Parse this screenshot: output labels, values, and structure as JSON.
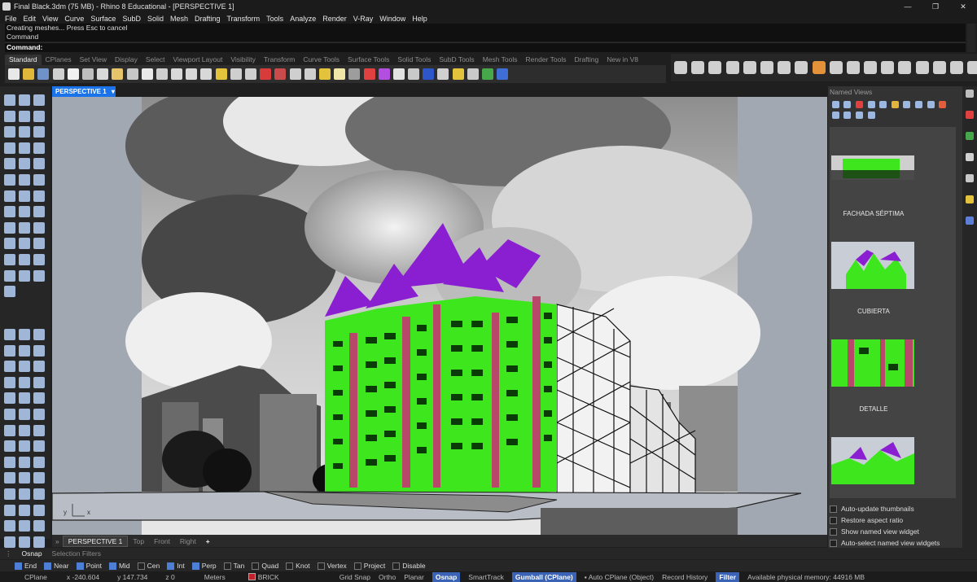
{
  "window": {
    "title": "Final Black.3dm (75 MB) - Rhino 8 Educational - [PERSPECTIVE 1]",
    "min": "—",
    "max": "❐",
    "close": "✕"
  },
  "menu": [
    "File",
    "Edit",
    "View",
    "Curve",
    "Surface",
    "SubD",
    "Solid",
    "Mesh",
    "Drafting",
    "Transform",
    "Tools",
    "Analyze",
    "Render",
    "V-Ray",
    "Window",
    "Help"
  ],
  "command": {
    "history_1": "Creating meshes... Press Esc to cancel",
    "history_2": "Command",
    "prompt": "Command:"
  },
  "toolbar_tabs": [
    {
      "label": "Standard",
      "active": true
    },
    {
      "label": "CPlanes"
    },
    {
      "label": "Set View"
    },
    {
      "label": "Display"
    },
    {
      "label": "Select"
    },
    {
      "label": "Viewport Layout"
    },
    {
      "label": "Visibility"
    },
    {
      "label": "Transform"
    },
    {
      "label": "Curve Tools"
    },
    {
      "label": "Surface Tools"
    },
    {
      "label": "Solid Tools"
    },
    {
      "label": "SubD Tools"
    },
    {
      "label": "Mesh Tools"
    },
    {
      "label": "Render Tools"
    },
    {
      "label": "Drafting"
    },
    {
      "label": "New in V8"
    }
  ],
  "viewport": {
    "name": "PERSPECTIVE 1",
    "dropdown": "▾",
    "axis_y": "y",
    "axis_x": "x"
  },
  "viewport_tabs": [
    {
      "label": "PERSPECTIVE 1",
      "active": true
    },
    {
      "label": "Top"
    },
    {
      "label": "Front"
    },
    {
      "label": "Right"
    },
    {
      "label": "+"
    }
  ],
  "named_views": {
    "title": "Named Views",
    "items": [
      {
        "name": "FACHADA SÉPTIMA"
      },
      {
        "name": "CUBIERTA"
      },
      {
        "name": "DETALLE"
      }
    ],
    "options": [
      {
        "label": "Auto-update thumbnails",
        "checked": false
      },
      {
        "label": "Restore aspect ratio",
        "checked": false
      },
      {
        "label": "Show named view widget",
        "checked": false
      },
      {
        "label": "Auto-select named view widgets",
        "checked": false
      }
    ]
  },
  "osnap_tabs": [
    "Osnap",
    "Selection Filters"
  ],
  "osnaps": [
    {
      "label": "End",
      "checked": true
    },
    {
      "label": "Near",
      "checked": true
    },
    {
      "label": "Point",
      "checked": true
    },
    {
      "label": "Mid",
      "checked": true
    },
    {
      "label": "Cen",
      "checked": false
    },
    {
      "label": "Int",
      "checked": true
    },
    {
      "label": "Perp",
      "checked": true
    },
    {
      "label": "Tan",
      "checked": false
    },
    {
      "label": "Quad",
      "checked": false
    },
    {
      "label": "Knot",
      "checked": false
    },
    {
      "label": "Vertex",
      "checked": false
    },
    {
      "label": "Project",
      "checked": false
    },
    {
      "label": "Disable",
      "checked": false
    }
  ],
  "status": {
    "cplane": "CPlane",
    "x": "x -240.604",
    "y": "y 147.734",
    "z": "z 0",
    "units": "Meters",
    "layer": "BRICK",
    "layer_color": "#c0222c",
    "grid_snap": "Grid Snap",
    "ortho": "Ortho",
    "planar": "Planar",
    "osnap": "Osnap",
    "smarttrack": "SmartTrack",
    "gumball": "Gumball (CPlane)",
    "auto_cplane": "Auto CPlane (Object)",
    "record_history": "Record History",
    "filter": "Filter",
    "memory": "Available physical memory: 44916 MB"
  },
  "colors": {
    "accent": "#1a73e8",
    "facade_green": "#3ee61e",
    "roof_purple": "#8a1fd1",
    "brick": "#b8486a",
    "status_pill": "#3b63b5"
  }
}
